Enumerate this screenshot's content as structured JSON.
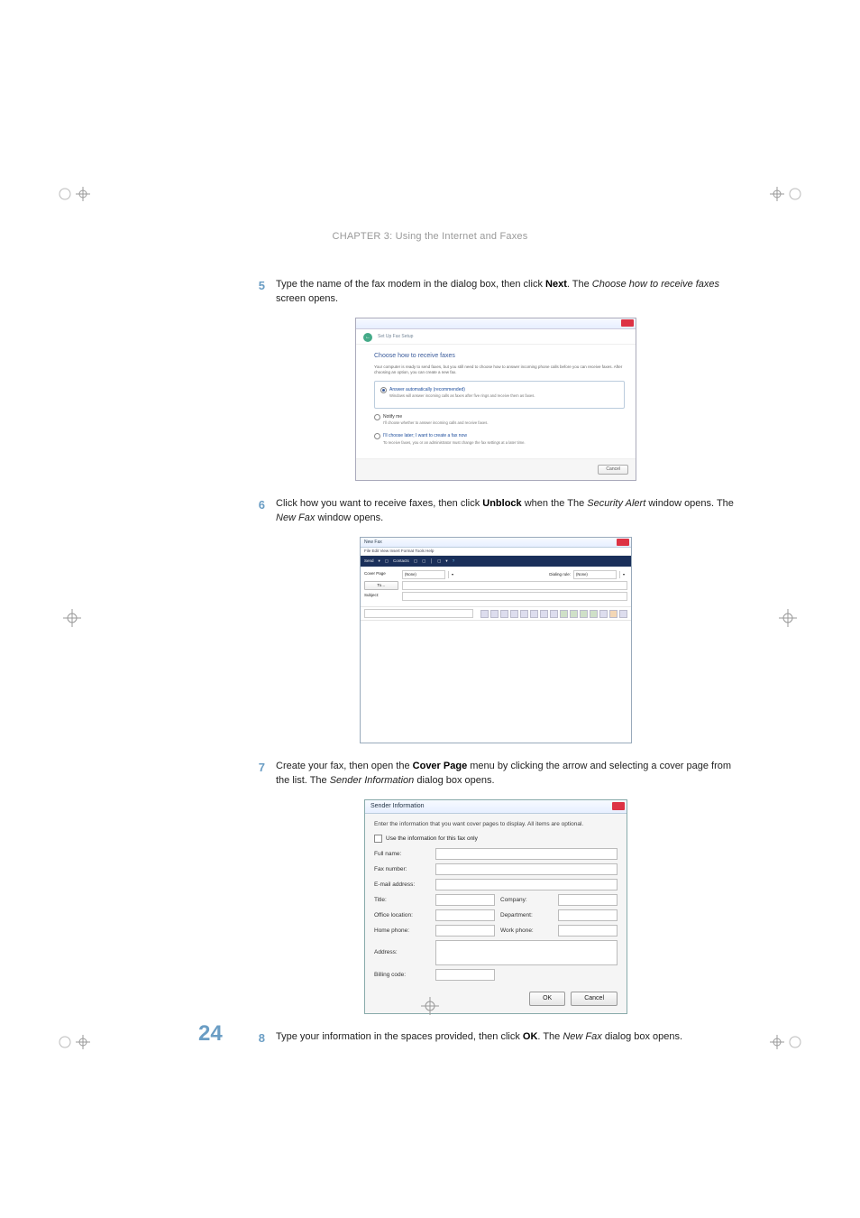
{
  "header": "CHAPTER 3: Using the Internet and Faxes",
  "page_number": "24",
  "steps": {
    "s5": {
      "n": "5",
      "a": "Type the name of the fax modem in the dialog box, then click ",
      "b": "Next",
      "c": ". The ",
      "i": "Choose how to receive faxes",
      "d": " screen opens."
    },
    "s6": {
      "n": "6",
      "a": "Click how you want to receive faxes, then click ",
      "b": "Unblock",
      "c": " when the The ",
      "i": "Security Alert",
      "d": " window opens. The ",
      "i2": "New Fax",
      "e": " window opens."
    },
    "s7": {
      "n": "7",
      "a": "Create your fax, then open the ",
      "b": "Cover Page",
      "c": " menu by clicking the arrow and selecting a cover page from the list. The ",
      "i": "Sender Information",
      "d": " dialog box opens."
    },
    "s8": {
      "n": "8",
      "a": "Type your information in the spaces provided, then click ",
      "b": "OK",
      "c": ". The ",
      "i": "New Fax",
      "d": " dialog box opens."
    }
  },
  "fig1": {
    "breadcrumb": "Set Up Fax Setup",
    "heading": "Choose how to receive faxes",
    "intro": "Your computer is ready to send faxes, but you still need to choose how to answer incoming phone calls before you can receive faxes. After choosing an option, you can create a new fax.",
    "opt1_t": "Answer automatically (recommended)",
    "opt1_d": "Windows will answer incoming calls as faxes after five rings and receive them as faxes.",
    "opt2_t": "Notify me",
    "opt2_d": "I'll choose whether to answer incoming calls and receive faxes.",
    "opt3_t": "I'll choose later; I want to create a fax now",
    "opt3_d": "To receive faxes, you or an administrator must change the fax settings at a later time.",
    "cancel": "Cancel"
  },
  "fig2": {
    "title": "New Fax",
    "menu": "File   Edit   View   Insert   Format   Tools   Help",
    "tb_send": "Send",
    "tb_contacts": "Contacts",
    "left_cover": "Cover Page",
    "left_to": "To…",
    "left_subject": "Subject:",
    "cover_val": "(None)",
    "dialing": "Dialing rule:",
    "dialing_val": "(None)"
  },
  "fig3": {
    "title": "Sender Information",
    "intro": "Enter the information that you want cover pages to display. All items are optional.",
    "chk": "Use the information for this fax only",
    "fullname": "Full name:",
    "faxnum": "Fax number:",
    "email": "E-mail address:",
    "titlelbl": "Title:",
    "company": "Company:",
    "office": "Office location:",
    "department": "Department:",
    "homephone": "Home phone:",
    "workphone": "Work phone:",
    "address": "Address:",
    "billing": "Billing code:",
    "ok": "OK",
    "cancel": "Cancel"
  }
}
